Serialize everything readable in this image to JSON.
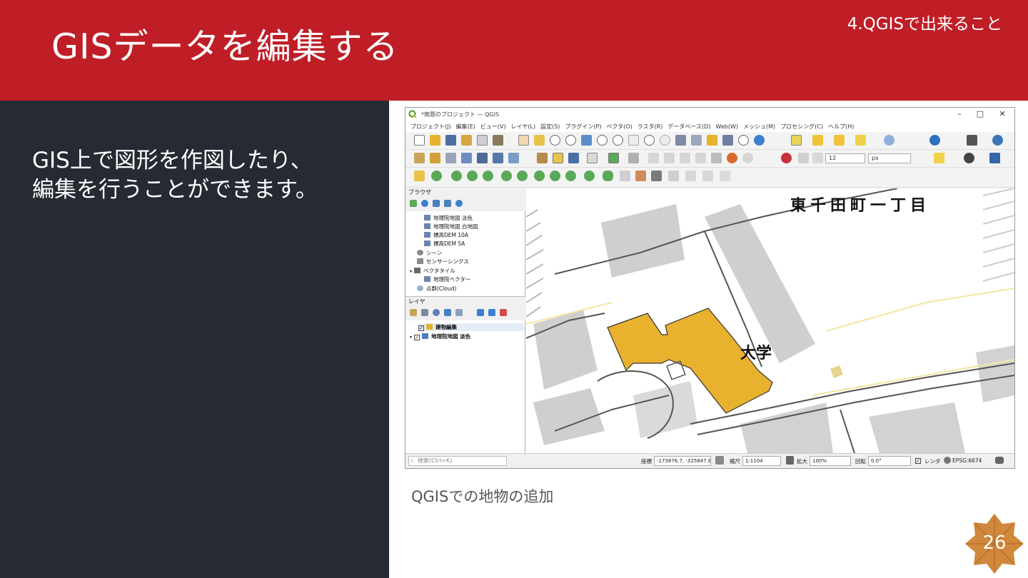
{
  "slide": {
    "title": "GISデータを編集する",
    "section": "4.QGISで出来ること",
    "body_lines": [
      "GIS上で図形を作図したり、",
      "編集を行うことができます。"
    ],
    "caption": "QGISでの地物の追加",
    "page_number": "26",
    "colors": {
      "header": "#bf1e27",
      "left_panel": "#262a33",
      "badge": "#d2883c",
      "feature_fill": "#e8b12e"
    }
  },
  "qgis": {
    "window_title": "*無題のプロジェクト — QGIS",
    "menu": [
      "プロジェクト(J)",
      "編集(E)",
      "ビュー(V)",
      "レイヤ(L)",
      "設定(S)",
      "プラグイン(P)",
      "ベクタ(O)",
      "ラスタ(R)",
      "データベース(D)",
      "Web(W)",
      "メッシュ(M)",
      "プロセシング(C)",
      "ヘルプ(H)"
    ],
    "toolbar": {
      "font_size_value": "12",
      "unit_value": "px"
    },
    "browser": {
      "title": "ブラウザ",
      "items": [
        "地理院地図 淡色",
        "地理院地図 白地図",
        "標高DEM 10A",
        "標高DEM 5A",
        "シーン",
        "センサーシングス",
        "ベクタタイル",
        "地理院ベクター",
        "点群(Cloud)"
      ]
    },
    "layers": {
      "title": "レイヤ",
      "items": [
        "建物編集",
        "地理院地図 淡色"
      ]
    },
    "map": {
      "label_top": "東千田町一丁目",
      "label_mid": "大学"
    },
    "status": {
      "search_placeholder": "検索(Ctrl+K)",
      "coord_label": "座標",
      "coord_value": "-173876.7, -325847.8",
      "scale_label": "縮尺",
      "scale_value": "1:1104",
      "zoom_label": "拡大",
      "zoom_value": "100%",
      "rotation_label": "回転",
      "rotation_value": "0.0°",
      "render_label": "レンダ",
      "crs": "EPSG:6674"
    }
  }
}
